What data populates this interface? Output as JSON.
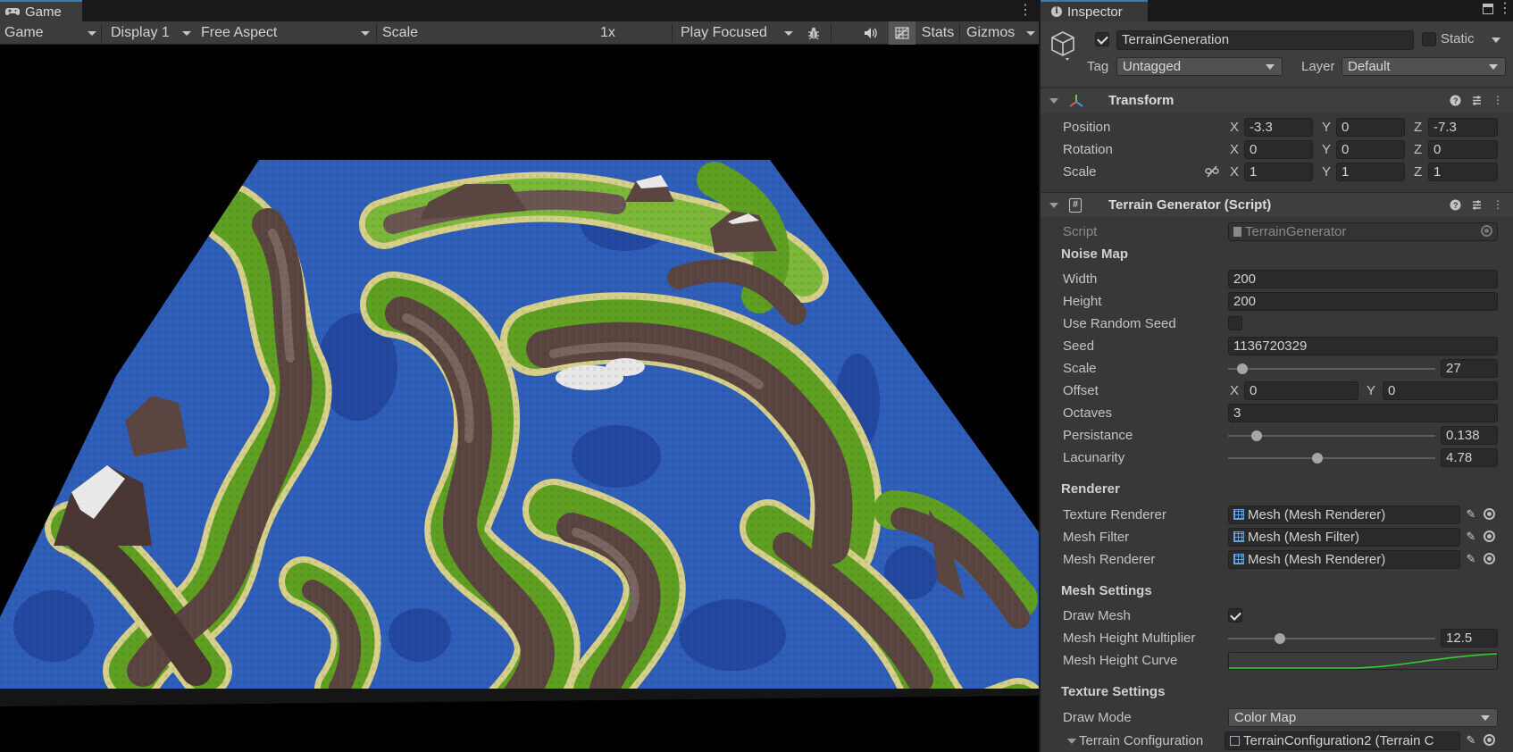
{
  "game": {
    "tab_label": "Game",
    "toolbar": {
      "mode": "Game",
      "display": "Display 1",
      "aspect": "Free Aspect",
      "scale_label": "Scale",
      "scale_value": "1x",
      "play_mode": "Play Focused",
      "stats": "Stats",
      "gizmos": "Gizmos"
    },
    "icons": [
      "gamepad-icon",
      "bug-icon",
      "speaker-icon",
      "grid-icon",
      "kebab-menu-icon"
    ]
  },
  "inspector": {
    "tab_label": "Inspector",
    "object": {
      "name": "TerrainGeneration",
      "active": true,
      "static_label": "Static",
      "tag_label": "Tag",
      "tag_value": "Untagged",
      "layer_label": "Layer",
      "layer_value": "Default"
    },
    "transform": {
      "title": "Transform",
      "position_label": "Position",
      "rotation_label": "Rotation",
      "scale_label": "Scale",
      "axis_x": "X",
      "axis_y": "Y",
      "axis_z": "Z",
      "position": {
        "x": "-3.3",
        "y": "0",
        "z": "-7.3"
      },
      "rotation": {
        "x": "0",
        "y": "0",
        "z": "0"
      },
      "scale": {
        "x": "1",
        "y": "1",
        "z": "1"
      }
    },
    "terrain_generator": {
      "title": "Terrain Generator (Script)",
      "script_label": "Script",
      "script_value": "TerrainGenerator",
      "noise_map_header": "Noise Map",
      "width_label": "Width",
      "width_value": "200",
      "height_label": "Height",
      "height_value": "200",
      "use_random_seed_label": "Use Random Seed",
      "use_random_seed": false,
      "seed_label": "Seed",
      "seed_value": "1136720329",
      "scale_label": "Scale",
      "scale_value": "27",
      "scale_fraction": 0.07,
      "offset_label": "Offset",
      "offset_x": "0",
      "offset_y": "0",
      "octaves_label": "Octaves",
      "octaves_value": "3",
      "persistance_label": "Persistance",
      "persistance_value": "0.138",
      "persistance_fraction": 0.14,
      "lacunarity_label": "Lacunarity",
      "lacunarity_value": "4.78",
      "lacunarity_fraction": 0.43,
      "renderer_header": "Renderer",
      "texture_renderer_label": "Texture Renderer",
      "texture_renderer_value": "Mesh (Mesh Renderer)",
      "mesh_filter_label": "Mesh Filter",
      "mesh_filter_value": "Mesh (Mesh Filter)",
      "mesh_renderer_label": "Mesh Renderer",
      "mesh_renderer_value": "Mesh (Mesh Renderer)",
      "mesh_settings_header": "Mesh Settings",
      "draw_mesh_label": "Draw Mesh",
      "draw_mesh": true,
      "mesh_height_multiplier_label": "Mesh Height Multiplier",
      "mesh_height_multiplier_value": "12.5",
      "mesh_height_multiplier_fraction": 0.25,
      "mesh_height_curve_label": "Mesh Height Curve",
      "texture_settings_header": "Texture Settings",
      "draw_mode_label": "Draw Mode",
      "draw_mode_value": "Color Map",
      "terrain_configuration_label": "Terrain Configuration",
      "terrain_configuration_value": "TerrainConfiguration2 (Terrain C"
    }
  },
  "colors": {
    "water": "#2f5fb8",
    "deep_water": "#2448a0",
    "sand": "#d6d08a",
    "grass": "#5fa022",
    "grass_light": "#7cb83a",
    "rock": "#5a4540",
    "rock_light": "#7a6660",
    "snow": "#e8e8e8",
    "curve": "#2fd12f"
  }
}
